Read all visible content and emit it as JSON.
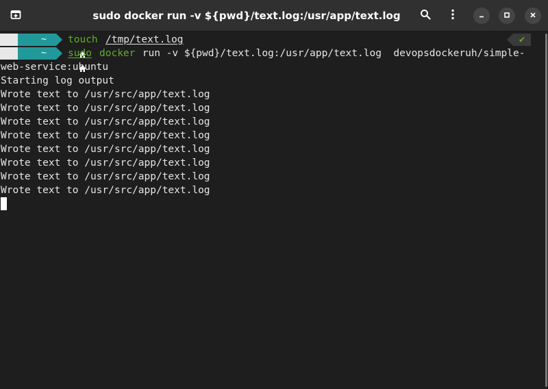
{
  "window": {
    "title": "sudo docker run -v ${pwd}/text.log:/usr/app/text.log"
  },
  "header": {
    "new_tab_icon": "new-tab-icon",
    "search_icon": "search-icon",
    "menu_icon": "kebab-menu-icon",
    "minimize_icon": "minimize-icon",
    "maximize_icon": "maximize-icon",
    "close_icon": "close-icon"
  },
  "prompt": {
    "dir": "~",
    "status_glyph": "✔"
  },
  "terminal": {
    "cmd1": {
      "command": "touch",
      "arg": "/tmp/text.log"
    },
    "cmd2": {
      "sudo": "sudo",
      "docker": "docker",
      "rest": " run -v ${pwd}/text.log:/usr/app/text.log  devopsdockeruh/simple-"
    },
    "wrapped": "web-service:ubuntu",
    "output": [
      "Starting log output",
      "Wrote text to /usr/src/app/text.log",
      "Wrote text to /usr/src/app/text.log",
      "Wrote text to /usr/src/app/text.log",
      "Wrote text to /usr/src/app/text.log",
      "Wrote text to /usr/src/app/text.log",
      "Wrote text to /usr/src/app/text.log",
      "Wrote text to /usr/src/app/text.log",
      "Wrote text to /usr/src/app/text.log"
    ]
  },
  "colors": {
    "background": "#1e1e1e",
    "header": "#303030",
    "prompt_dir_bg": "#21999a",
    "command_green": "#5faf2c",
    "text": "#e6e6e6"
  }
}
